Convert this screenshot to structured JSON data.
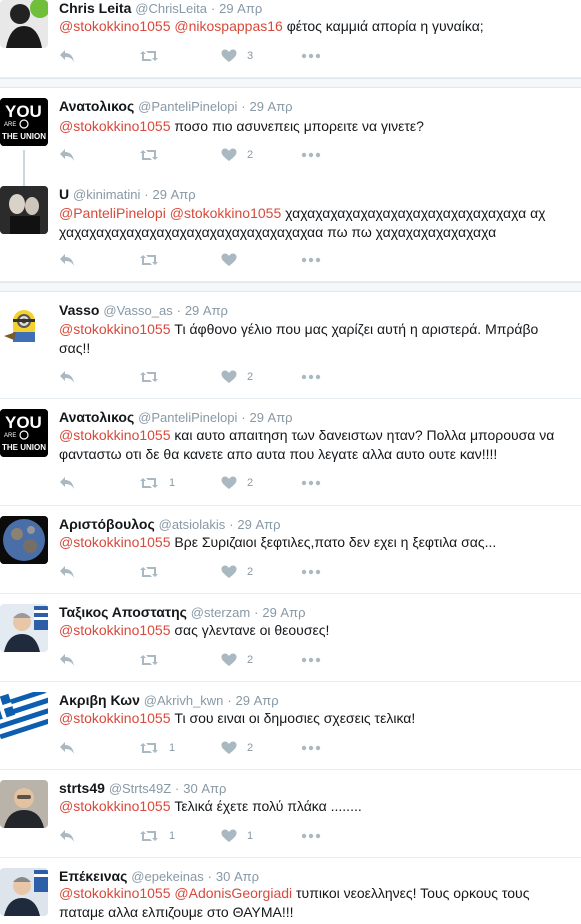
{
  "tweets": [
    {
      "name": "Chris Leita",
      "handle": "@ChrisLeita",
      "date": "29 Απρ",
      "parts": [
        {
          "t": "@stokokkino1055",
          "m": true
        },
        {
          "t": " "
        },
        {
          "t": "@nikospappas16",
          "m": true
        },
        {
          "t": " φέτος καμμιά απορία η γυναίκα;"
        }
      ],
      "retweets": "",
      "likes": "3"
    },
    {
      "name": "Ανατολικος",
      "handle": "@PanteliPinelopi",
      "date": "29 Απρ",
      "parts": [
        {
          "t": "@stokokkino1055",
          "m": true
        },
        {
          "t": " ποσο πιο ασυνεπεις μπορειτε να γινετε?"
        }
      ],
      "retweets": "",
      "likes": "2"
    },
    {
      "name": "U",
      "handle": "@kinimatini",
      "date": "29 Απρ",
      "parts": [
        {
          "t": "@PanteliPinelopi",
          "m": true
        },
        {
          "t": " "
        },
        {
          "t": "@stokokkino1055",
          "m": true
        },
        {
          "t": " χαχαχαχαχαχαχαχαχαχαχαχαχαχαχαχα αχ χαχαχαχαχαχαχαχαχαχαχαχαχαχαχαχαχαα πω πω χαχαχαχαχαχαχαχα"
        }
      ],
      "retweets": "",
      "likes": ""
    },
    {
      "name": "Vasso",
      "handle": "@Vasso_as",
      "date": "29 Απρ",
      "parts": [
        {
          "t": "@stokokkino1055",
          "m": true
        },
        {
          "t": " Τι άφθονο γέλιο που μας χαρίζει αυτή η αριστερά. Μπράβο σας!!"
        }
      ],
      "retweets": "",
      "likes": "2"
    },
    {
      "name": "Ανατολικος",
      "handle": "@PanteliPinelopi",
      "date": "29 Απρ",
      "parts": [
        {
          "t": "@stokokkino1055",
          "m": true
        },
        {
          "t": " και αυτο απαιτηση των δανειστων ηταν? Πολλα μπορουσα να φανταστω οτι δε θα κανετε απο αυτα που λεγατε αλλα αυτο ουτε καν!!!!"
        }
      ],
      "retweets": "1",
      "likes": "2"
    },
    {
      "name": "Αριστόβουλος",
      "handle": "@atsiolakis",
      "date": "29 Απρ",
      "parts": [
        {
          "t": "@stokokkino1055",
          "m": true
        },
        {
          "t": " Βρε Συριζαιοι ξεφτιλες,πατο δεν εχει η ξεφτιλα σας..."
        }
      ],
      "retweets": "",
      "likes": "2"
    },
    {
      "name": "Ταξικος Αποστατης",
      "handle": "@sterzam",
      "date": "29 Απρ",
      "parts": [
        {
          "t": "@stokokkino1055",
          "m": true
        },
        {
          "t": " σας γλεντανε οι θεουσες!"
        }
      ],
      "retweets": "",
      "likes": "2"
    },
    {
      "name": "Ακριβη Κων",
      "handle": "@Akrivh_kwn",
      "date": "29 Απρ",
      "parts": [
        {
          "t": "@stokokkino1055",
          "m": true
        },
        {
          "t": " Τι σου ειναι οι δημοσιες σχεσεις τελικα!"
        }
      ],
      "retweets": "1",
      "likes": "2"
    },
    {
      "name": "strts49",
      "handle": "@Strts49Z",
      "date": "30 Απρ",
      "parts": [
        {
          "t": "@stokokkino1055",
          "m": true
        },
        {
          "t": " Τελικά έχετε πολύ πλάκα ........"
        }
      ],
      "retweets": "1",
      "likes": "1"
    },
    {
      "name": "Επέκεινας",
      "handle": "@epekeinas",
      "date": "30 Απρ",
      "parts": [
        {
          "t": "@stokokkino1055",
          "m": true
        },
        {
          "t": " "
        },
        {
          "t": "@AdonisGeorgiadi",
          "m": true
        },
        {
          "t": " τυπικοι νεοελληνες! Τους ορκους τους παταμε αλλα ελπιζουμε στο ΘΑΥΜΑ!!!"
        }
      ],
      "retweets": "",
      "likes": ""
    }
  ],
  "avatar_labels": {
    "union_top": "YOU",
    "union_mid": "ARE",
    "union_bottom": "THE UNION"
  },
  "colors": {
    "mention": "#d7493b",
    "muted": "#8899a6"
  }
}
